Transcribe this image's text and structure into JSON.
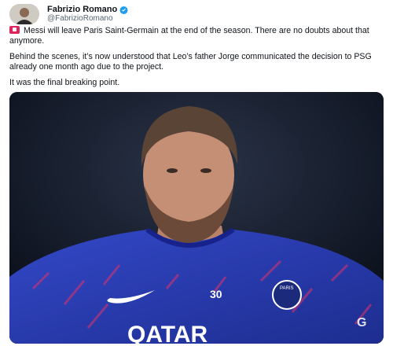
{
  "author": {
    "name": "Fabrizio Romano",
    "handle": "@FabrizioRomano"
  },
  "tweet": {
    "line1": "Messi will leave Paris Saint-Germain at the end of the season. There are no doubts about that anymore.",
    "line2": "Behind the scenes, it’s now understood that Leo’s father Jorge communicated the decision to PSG already one month ago due to the project.",
    "line3": "It was the final breaking point."
  },
  "media": {
    "jersey_number": "30",
    "sponsor": "QATAR",
    "badge_text": "PARIS",
    "partial_text": "G"
  },
  "colors": {
    "verified": "#1d9bf0",
    "flag": "#e0245e",
    "jersey": "#2b3fb8",
    "background": "#0c1322"
  }
}
